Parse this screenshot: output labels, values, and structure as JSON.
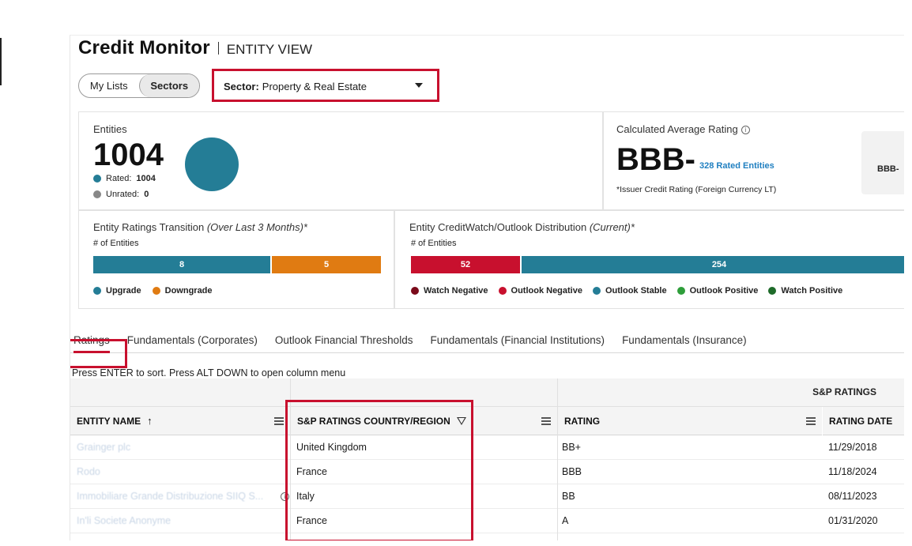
{
  "header": {
    "app_title": "Credit Monitor",
    "view_title": "ENTITY VIEW"
  },
  "toggle": {
    "my_lists": "My Lists",
    "sectors": "Sectors",
    "active": "Sectors"
  },
  "sector_select": {
    "label": "Sector:",
    "value": "Property & Real Estate"
  },
  "entities": {
    "title": "Entities",
    "count": "1004",
    "rated_label": "Rated:",
    "rated_value": "1004",
    "unrated_label": "Unrated:",
    "unrated_value": "0",
    "rated_color": "#247d96",
    "unrated_color": "#888888"
  },
  "average_rating": {
    "title": "Calculated Average Rating",
    "rating": "BBB-",
    "rated_entities_link": "328 Rated Entities",
    "note": "*Issuer Credit Rating (Foreign Currency LT)",
    "side_value": "BBB-"
  },
  "transition": {
    "title": "Entity Ratings Transition",
    "title_italic": "(Over Last 3 Months)*",
    "y_label": "# of Entities",
    "upgrade_value": "8",
    "downgrade_value": "5",
    "upgrade_label": "Upgrade",
    "downgrade_label": "Downgrade",
    "upgrade_color": "#247d96",
    "downgrade_color": "#e07b12"
  },
  "creditwatch": {
    "title": "Entity CreditWatch/Outlook Distribution",
    "title_italic": "(Current)*",
    "y_label": "# of Entities",
    "negative_value": "52",
    "stable_value": "254",
    "legend": [
      {
        "label": "Watch Negative",
        "color": "#7a0a1a"
      },
      {
        "label": "Outlook Negative",
        "color": "#c8102e"
      },
      {
        "label": "Outlook Stable",
        "color": "#247d96"
      },
      {
        "label": "Outlook Positive",
        "color": "#2e9e3a"
      },
      {
        "label": "Watch Positive",
        "color": "#1e6b2a"
      }
    ]
  },
  "tabs": [
    "Ratings",
    "Fundamentals (Corporates)",
    "Outlook Financial Thresholds",
    "Fundamentals (Financial Institutions)",
    "Fundamentals (Insurance)"
  ],
  "grid": {
    "hint": "Press ENTER to sort. Press ALT DOWN to open column menu",
    "group_label": "S&P RATINGS",
    "col_entity": "ENTITY NAME",
    "col_country": "S&P RATINGS COUNTRY/REGION",
    "col_rating": "RATING",
    "col_date": "RATING DATE",
    "rows": [
      {
        "entity": "Grainger plc",
        "country": "United Kingdom",
        "rating": "BB+",
        "date": "11/29/2018"
      },
      {
        "entity": "Rodo",
        "country": "France",
        "rating": "BBB",
        "date": "11/18/2024"
      },
      {
        "entity": "Immobiliare Grande Distribuzione SIIQ S...",
        "country": "Italy",
        "rating": "BB",
        "date": "08/11/2023"
      },
      {
        "entity": "In'li Societe Anonyme",
        "country": "France",
        "rating": "A",
        "date": "01/31/2020"
      }
    ]
  }
}
